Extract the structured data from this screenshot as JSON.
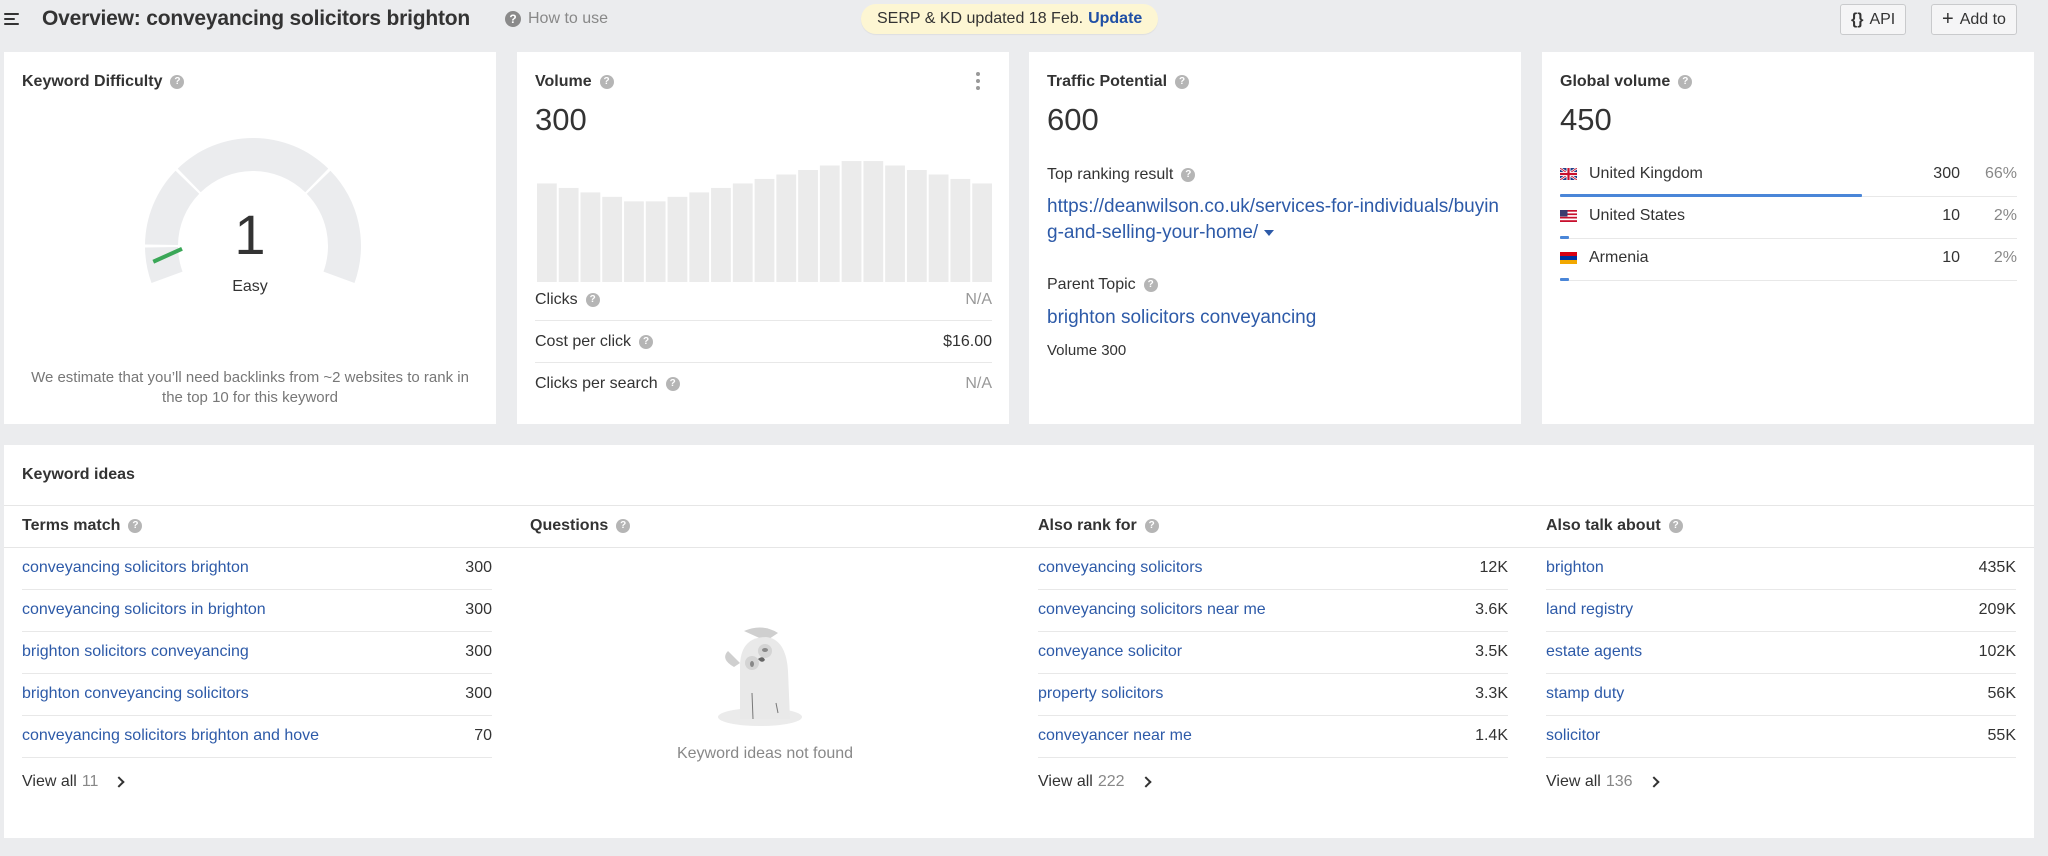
{
  "header": {
    "title": "Overview: conveyancing solicitors brighton",
    "how_to_use": "How to use",
    "notice_text": "SERP & KD updated 18 Feb.",
    "notice_link": "Update",
    "api_button": "API",
    "add_to_button": "Add to",
    "icons": {
      "menu": "hamburger-icon",
      "help": "question-circle-icon",
      "api": "curly-braces-icon",
      "add": "plus-icon"
    }
  },
  "keyword_difficulty": {
    "title": "Keyword Difficulty",
    "value": "1",
    "score": 1,
    "scale_max": 100,
    "label": "Easy",
    "indicator_color": "#3aa757",
    "note": "We estimate that you’ll need backlinks from ~2 websites to rank in the top 10 for this keyword"
  },
  "volume": {
    "title": "Volume",
    "value": "300",
    "trend_relative": [
      0.66,
      0.63,
      0.6,
      0.57,
      0.54,
      0.54,
      0.57,
      0.6,
      0.63,
      0.66,
      0.69,
      0.72,
      0.75,
      0.78,
      0.81,
      0.81,
      0.78,
      0.75,
      0.72,
      0.69,
      0.66
    ],
    "metrics": [
      {
        "label": "Clicks",
        "value": "N/A",
        "na": true
      },
      {
        "label": "Cost per click",
        "value": "$16.00",
        "na": false
      },
      {
        "label": "Clicks per search",
        "value": "N/A",
        "na": true
      }
    ]
  },
  "traffic_potential": {
    "title": "Traffic Potential",
    "value": "600",
    "top_ranking_label": "Top ranking result",
    "top_ranking_url": "https://deanwilson.co.uk/services-for-individuals/buying-and-selling-your-home/",
    "parent_topic_label": "Parent Topic",
    "parent_topic": "brighton solicitors conveyancing",
    "parent_topic_volume": "Volume 300"
  },
  "global_volume": {
    "title": "Global volume",
    "value": "450",
    "accent_color": "#4a86d8",
    "countries": [
      {
        "name": "United Kingdom",
        "flag": "gb-flag-icon",
        "volume": "300",
        "percent": "66%",
        "share": 0.66
      },
      {
        "name": "United States",
        "flag": "us-flag-icon",
        "volume": "10",
        "percent": "2%",
        "share": 0.02
      },
      {
        "name": "Armenia",
        "flag": "am-flag-icon",
        "volume": "10",
        "percent": "2%",
        "share": 0.02
      }
    ]
  },
  "keyword_ideas": {
    "title": "Keyword ideas",
    "view_all_label": "View all",
    "columns": [
      {
        "title": "Terms match",
        "view_all_count": "11",
        "rows": [
          {
            "keyword": "conveyancing solicitors brighton",
            "volume": "300"
          },
          {
            "keyword": "conveyancing solicitors in brighton",
            "volume": "300"
          },
          {
            "keyword": "brighton solicitors conveyancing",
            "volume": "300"
          },
          {
            "keyword": "brighton conveyancing solicitors",
            "volume": "300"
          },
          {
            "keyword": "conveyancing solicitors brighton and hove",
            "volume": "70"
          }
        ]
      },
      {
        "title": "Questions",
        "empty_text": "Keyword ideas not found",
        "rows": []
      },
      {
        "title": "Also rank for",
        "view_all_count": "222",
        "rows": [
          {
            "keyword": "conveyancing solicitors",
            "volume": "12K"
          },
          {
            "keyword": "conveyancing solicitors near me",
            "volume": "3.6K"
          },
          {
            "keyword": "conveyance solicitor",
            "volume": "3.5K"
          },
          {
            "keyword": "property solicitors",
            "volume": "3.3K"
          },
          {
            "keyword": "conveyancer near me",
            "volume": "1.4K"
          }
        ]
      },
      {
        "title": "Also talk about",
        "view_all_count": "136",
        "rows": [
          {
            "keyword": "brighton",
            "volume": "435K"
          },
          {
            "keyword": "land registry",
            "volume": "209K"
          },
          {
            "keyword": "estate agents",
            "volume": "102K"
          },
          {
            "keyword": "stamp duty",
            "volume": "56K"
          },
          {
            "keyword": "solicitor",
            "volume": "55K"
          }
        ]
      }
    ]
  }
}
